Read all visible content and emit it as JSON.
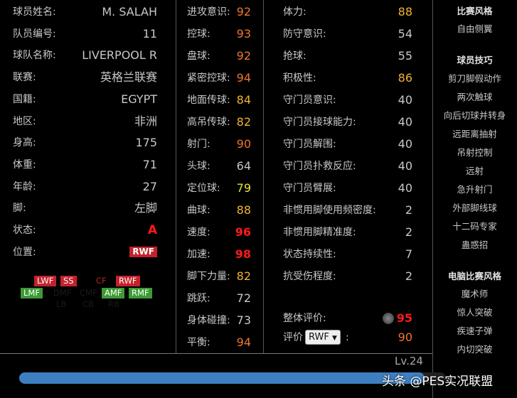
{
  "profile": [
    {
      "label": "球员姓名:",
      "value": "M. SALAH"
    },
    {
      "label": "队员编号:",
      "value": "11"
    },
    {
      "label": "球队名称:",
      "value": "LIVERPOOL R"
    },
    {
      "label": "联赛:",
      "value": "英格兰联赛"
    },
    {
      "label": "国籍:",
      "value": "EGYPT"
    },
    {
      "label": "地区:",
      "value": "非洲"
    },
    {
      "label": "身高:",
      "value": "175"
    },
    {
      "label": "体重:",
      "value": "71"
    },
    {
      "label": "年龄:",
      "value": "27"
    },
    {
      "label": "脚:",
      "value": "左脚"
    },
    {
      "label": "状态:",
      "value": "A"
    },
    {
      "label": "位置:",
      "value": "RWF"
    }
  ],
  "positions": {
    "row1": [
      {
        "label": "LWF",
        "style": "red"
      },
      {
        "label": "SS",
        "style": "red"
      },
      {
        "label": "CF",
        "style": "dim-red"
      },
      {
        "label": "RWF",
        "style": "red"
      }
    ],
    "row2": [
      {
        "label": "LMF",
        "style": "green"
      },
      {
        "label": "DMF",
        "style": "faint"
      },
      {
        "label": "CMF",
        "style": "faint"
      },
      {
        "label": "AMF",
        "style": "green"
      },
      {
        "label": "RMF",
        "style": "green"
      }
    ],
    "row3": [
      {
        "label": "LB",
        "style": "faint"
      },
      {
        "label": "CB",
        "style": "faint"
      },
      {
        "label": "RB",
        "style": "faint"
      }
    ]
  },
  "abilities1": [
    {
      "label": "进攻意识:",
      "value": "92"
    },
    {
      "label": "控球:",
      "value": "93"
    },
    {
      "label": "盘球:",
      "value": "92"
    },
    {
      "label": "紧密控球:",
      "value": "94"
    },
    {
      "label": "地面传球:",
      "value": "84"
    },
    {
      "label": "高吊传球:",
      "value": "82"
    },
    {
      "label": "射门:",
      "value": "90"
    },
    {
      "label": "头球:",
      "value": "64"
    },
    {
      "label": "定位球:",
      "value": "79"
    },
    {
      "label": "曲球:",
      "value": "88"
    },
    {
      "label": "速度:",
      "value": "96"
    },
    {
      "label": "加速:",
      "value": "98"
    },
    {
      "label": "脚下力量:",
      "value": "82"
    },
    {
      "label": "跳跃:",
      "value": "72"
    },
    {
      "label": "身体碰撞:",
      "value": "73"
    },
    {
      "label": "平衡:",
      "value": "94"
    }
  ],
  "abilities2": [
    {
      "label": "体力:",
      "value": "88"
    },
    {
      "label": "防守意识:",
      "value": "54"
    },
    {
      "label": "抢球:",
      "value": "55"
    },
    {
      "label": "积极性:",
      "value": "86"
    },
    {
      "label": "守门员意识:",
      "value": "40"
    },
    {
      "label": "守门员接球能力:",
      "value": "40"
    },
    {
      "label": "守门员解围:",
      "value": "40"
    },
    {
      "label": "守门员扑救反应:",
      "value": "40"
    },
    {
      "label": "守门员臂展:",
      "value": "40"
    },
    {
      "label": "非惯用脚使用频密度:",
      "value": "2"
    },
    {
      "label": "非惯用脚精准度:",
      "value": "2"
    },
    {
      "label": "状态持续性:",
      "value": "7"
    },
    {
      "label": "抗受伤程度:",
      "value": "2"
    }
  ],
  "overall": {
    "label": "整体评价:",
    "value": "95"
  },
  "rating": {
    "label": "评价",
    "select": "RWF",
    "suffix": ":",
    "value": "90"
  },
  "level": "Lv.24",
  "progress": 0.95,
  "watermark": "头条 @PES实况联盟",
  "sidebar": {
    "style_title": "比赛风格",
    "style": [
      "自由侧翼"
    ],
    "skills_title": "球员技巧",
    "skills": [
      "剪刀脚假动作",
      "两次触球",
      "向后切球并转身",
      "远距离抽射",
      "吊射控制",
      "远射",
      "急升射门",
      "外部脚线球",
      "十二码专家",
      "蛊惑招"
    ],
    "ai_title": "电脑比赛风格",
    "ai": [
      "魔术师",
      "惊人突破",
      "疾速子弹",
      "内切突破"
    ]
  }
}
